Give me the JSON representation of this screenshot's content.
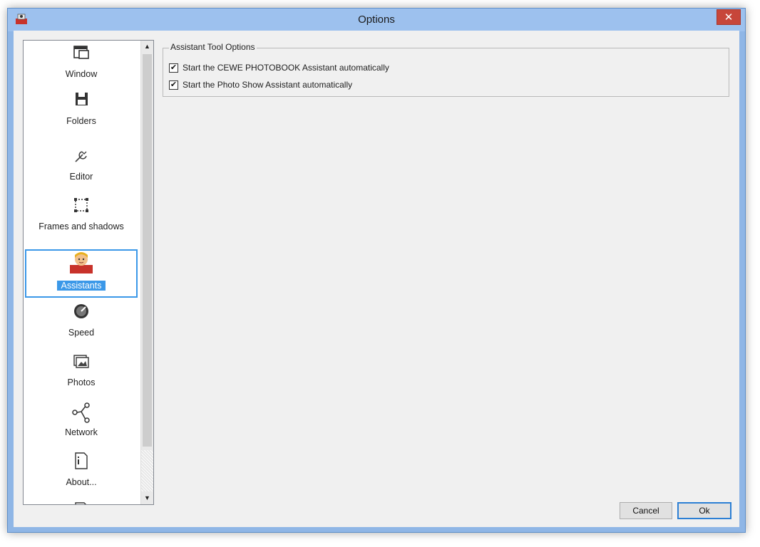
{
  "window": {
    "title": "Options",
    "close_glyph": "✕"
  },
  "nav": {
    "items": [
      {
        "label": "Window",
        "icon": "window-icon"
      },
      {
        "label": "Folders",
        "icon": "floppy-disk-icon"
      },
      {
        "label": "Editor",
        "icon": "wrench-icon"
      },
      {
        "label": "Frames and shadows",
        "icon": "frame-icon"
      },
      {
        "label": "Assistants",
        "icon": "assistant-person-icon",
        "selected": true
      },
      {
        "label": "Speed",
        "icon": "speedometer-icon"
      },
      {
        "label": "Photos",
        "icon": "photos-icon"
      },
      {
        "label": "Network",
        "icon": "network-icon"
      },
      {
        "label": "About...",
        "icon": "info-document-icon"
      }
    ]
  },
  "assistant_options": {
    "group_title": "Assistant Tool Options",
    "checkboxes": [
      {
        "label": "Start the CEWE PHOTOBOOK Assistant automatically",
        "checked": true
      },
      {
        "label": "Start the Photo Show Assistant automatically",
        "checked": true
      }
    ]
  },
  "buttons": {
    "cancel": "Cancel",
    "ok": "Ok"
  },
  "colors": {
    "selection": "#3b98e8",
    "titlebar": "#9dc1ee",
    "close": "#c7463a"
  }
}
